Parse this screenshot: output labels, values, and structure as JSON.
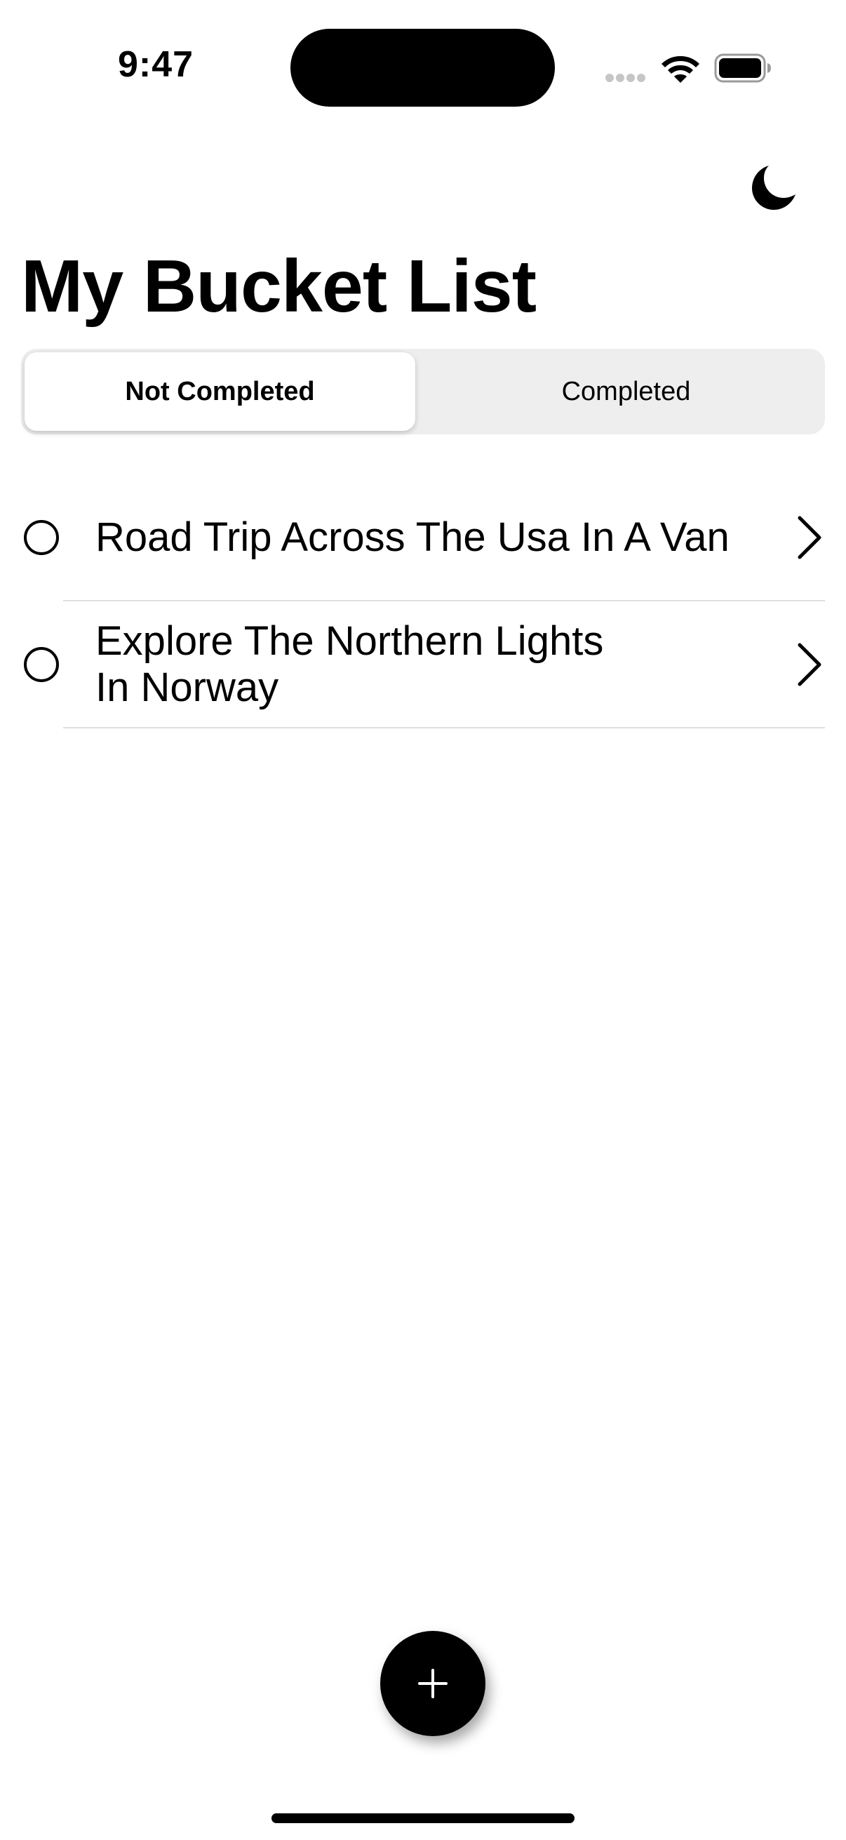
{
  "status_bar": {
    "time": "9:47",
    "icons": [
      "signal-icon",
      "wifi-icon",
      "battery-icon"
    ]
  },
  "header": {
    "theme_toggle_icon": "moon-icon",
    "title": "My Bucket List"
  },
  "tabs": [
    {
      "label": "Not Completed",
      "selected": true
    },
    {
      "label": "Completed",
      "selected": false
    }
  ],
  "items": [
    {
      "title": "Road Trip Across The Usa In A Van",
      "completed": false
    },
    {
      "title": "Explore The Northern Lights In Norway",
      "completed": false
    }
  ],
  "actions": {
    "add_icon": "plus-icon"
  },
  "colors": {
    "background": "#ffffff",
    "text": "#000000",
    "segment_bg": "#eeeeee",
    "separator": "#dedede"
  }
}
